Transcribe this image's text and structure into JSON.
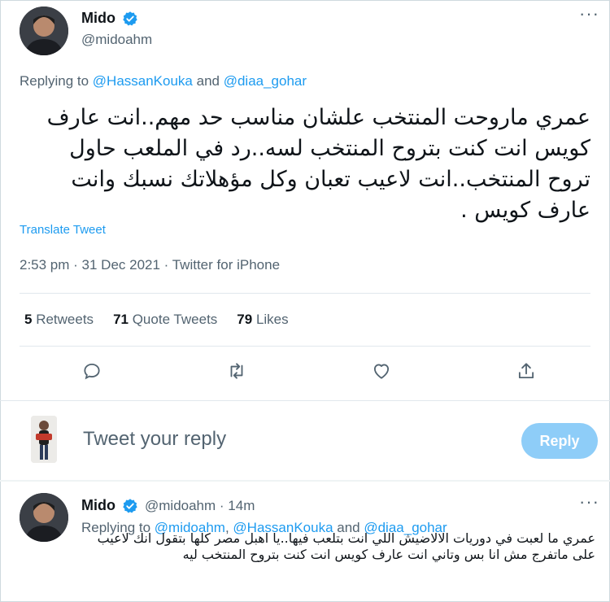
{
  "main_tweet": {
    "author_name": "Mido",
    "author_handle": "@midoahm",
    "replying_prefix": "Replying to ",
    "replying_to_1": "@HassanKouka",
    "replying_and": " and ",
    "replying_to_2": "@diaa_gohar",
    "text": "عمري ماروحت المنتخب علشان مناسب حد مهم..انت عارف كويس انت كنت بتروح المنتخب لسه..رد في الملعب حاول تروح المنتخب..انت لاعيب تعبان وكل مؤهلاتك نسبك وانت عارف كويس .",
    "translate_label": "Translate Tweet",
    "timestamp": "2:53 pm · 31 Dec 2021 · Twitter for iPhone",
    "stats": {
      "retweets_count": "5",
      "retweets_label": " Retweets",
      "quotes_count": "71",
      "quotes_label": " Quote Tweets",
      "likes_count": "79",
      "likes_label": " Likes"
    }
  },
  "compose": {
    "placeholder": "Tweet your reply",
    "button_label": "Reply"
  },
  "reply_tweet": {
    "author_name": "Mido",
    "author_handle": "@midoahm",
    "time": "· 14m",
    "replying_prefix": "Replying to ",
    "replying_to_1": "@midoahm",
    "replying_comma": ", ",
    "replying_to_2": "@HassanKouka",
    "replying_and": " and ",
    "replying_to_3": "@diaa_gohar",
    "text": "عمري ما لعبت في دوريات الالاضيش اللي انت بتلعب فيها..يا اهبل مصر كلها بتقول انك لاعيب على ماتفرج مش انا بس وتاني انت عارف كويس انت كنت بتروح المنتخب ليه"
  },
  "colors": {
    "accent": "#1d9bf0",
    "secondary_text": "#536471",
    "reply_button_disabled": "#8ecdf8"
  }
}
